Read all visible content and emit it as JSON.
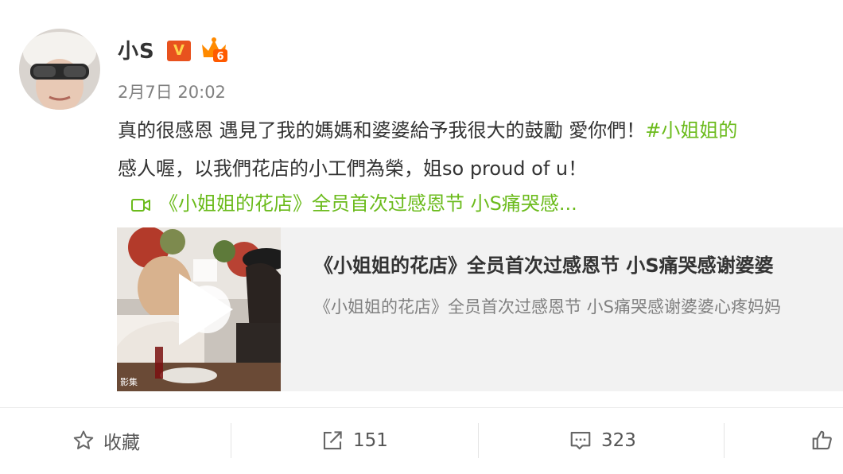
{
  "post": {
    "username": "小S",
    "verified_badge": "V",
    "level_badge": "6",
    "timestamp": "2月7日 20:02",
    "text_line1": "真的很感恩 遇見了我的媽媽和婆婆給予我很大的鼓勵 愛你們！",
    "hashtag": "#小姐姐的",
    "text_line2": "感人喔，以我們花店的小工們為榮，姐so proud of u！",
    "video_link": "《小姐姐的花店》全员首次过感恩节 小S痛哭感..."
  },
  "card": {
    "title": "《小姐姐的花店》全员首次过感恩节 小S痛哭感谢婆婆",
    "description": "《小姐姐的花店》全员首次过感恩节 小S痛哭感谢婆婆心疼妈妈",
    "thumb_caption": "影集"
  },
  "actions": {
    "favorite_label": "收藏",
    "repost_count": "151",
    "comment_count": "323"
  },
  "colors": {
    "hashtag": "#6bbb1c",
    "badge": "#e8521e",
    "text": "#333333",
    "muted": "#808080"
  }
}
